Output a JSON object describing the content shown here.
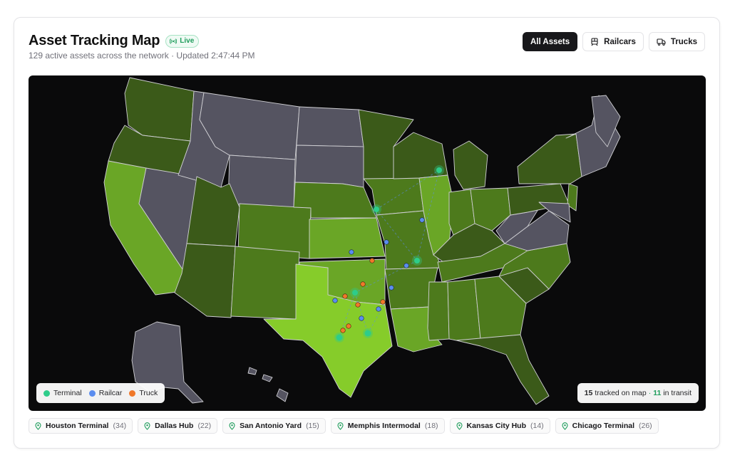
{
  "header": {
    "title": "Asset Tracking Map",
    "live_label": "Live",
    "subtitle": "129 active assets across the network · Updated 2:47:44 PM"
  },
  "filters": [
    {
      "label": "All Assets",
      "active": true,
      "icon": ""
    },
    {
      "label": "Railcars",
      "active": false,
      "icon": "train-icon"
    },
    {
      "label": "Trucks",
      "active": false,
      "icon": "truck-icon"
    }
  ],
  "colors": {
    "terminal": "#2ecc8a",
    "railcar": "#5b8def",
    "truck": "#f0782a",
    "inactive_state": "#555461",
    "dark_green": "#3b5a19",
    "mid_green": "#4d7a1c",
    "light_green": "#6aa626",
    "bright_green": "#86cc2a"
  },
  "legend": [
    {
      "label": "Terminal",
      "color": "#2ecc8a"
    },
    {
      "label": "Railcar",
      "color": "#5b8def"
    },
    {
      "label": "Truck",
      "color": "#f0782a"
    }
  ],
  "map_status": {
    "tracked_count": "15",
    "tracked_label": "tracked on map",
    "separator": "·",
    "transit_count": "11",
    "transit_label": "in transit"
  },
  "hubs": [
    {
      "name": "Houston Terminal",
      "count": "(34)"
    },
    {
      "name": "Dallas Hub",
      "count": "(22)"
    },
    {
      "name": "San Antonio Yard",
      "count": "(15)"
    },
    {
      "name": "Memphis Intermodal",
      "count": "(18)"
    },
    {
      "name": "Kansas City Hub",
      "count": "(14)"
    },
    {
      "name": "Chicago Terminal",
      "count": "(26)"
    }
  ]
}
